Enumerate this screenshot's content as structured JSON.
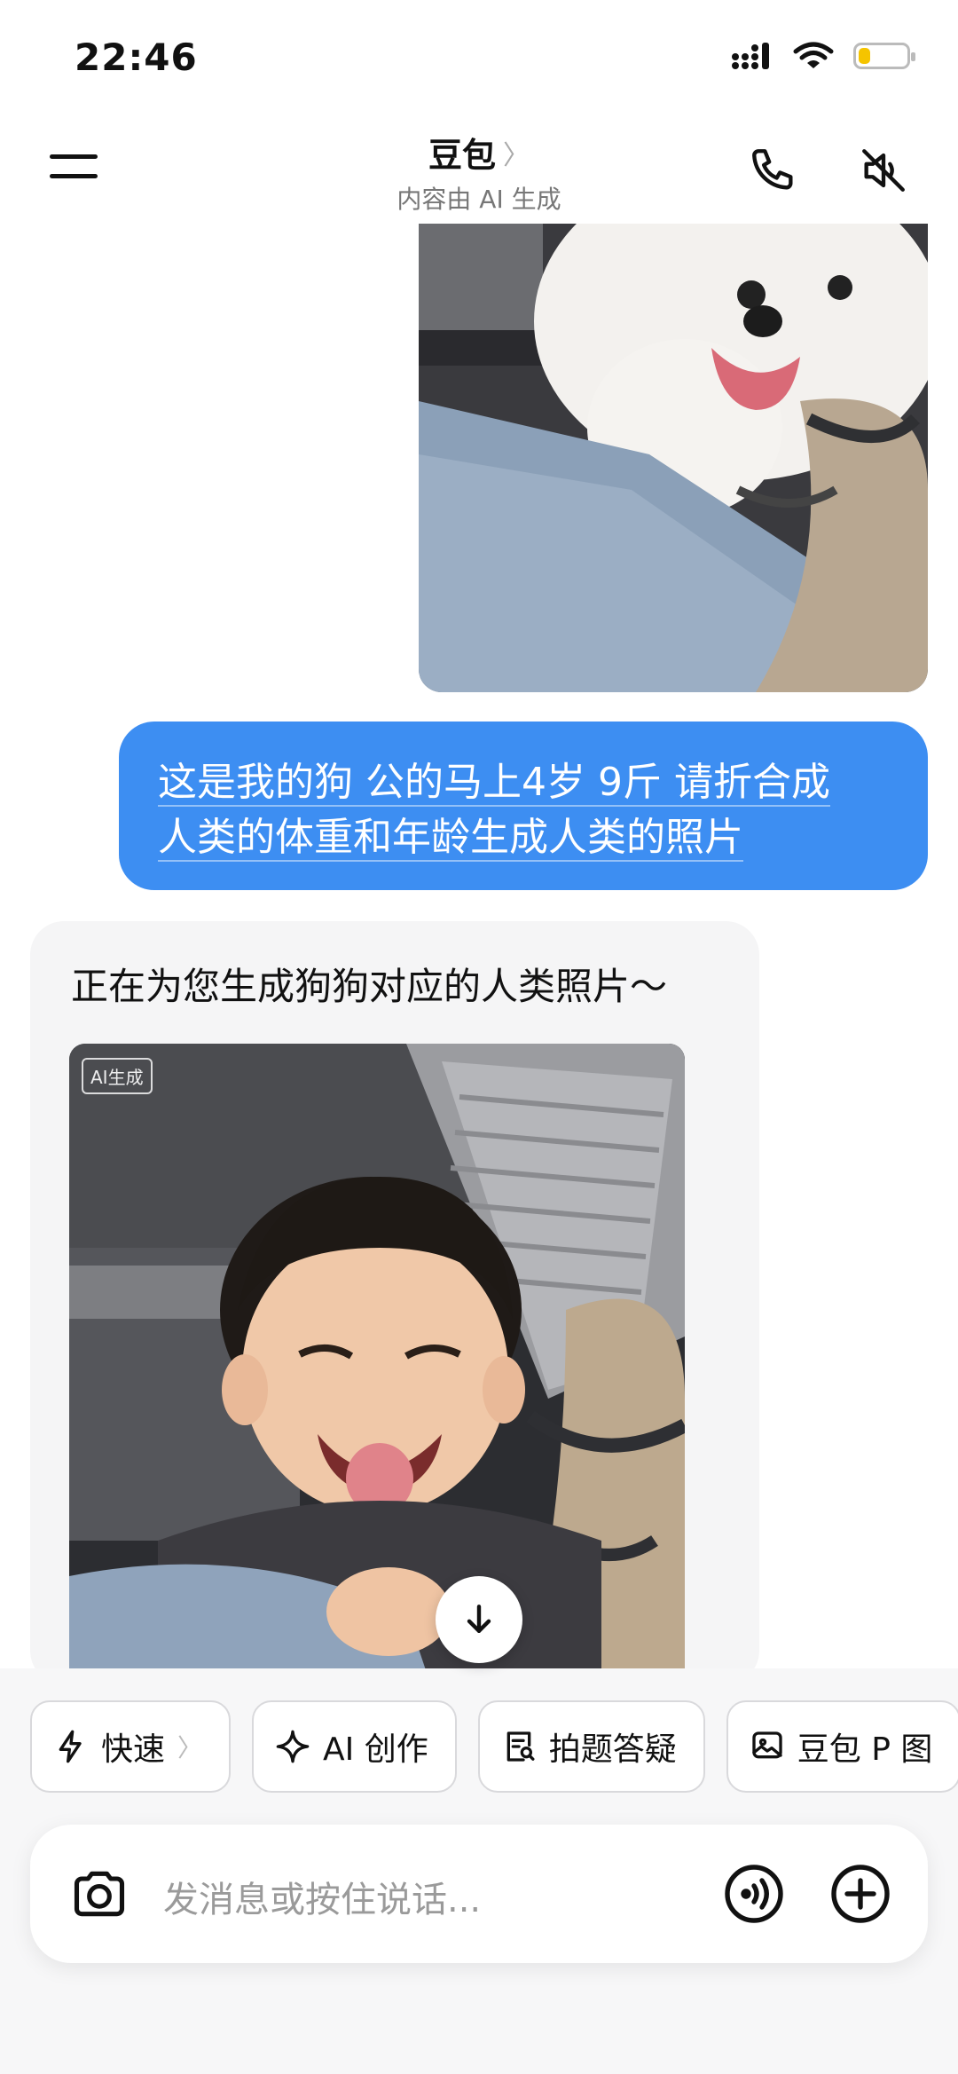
{
  "status_bar": {
    "time": "22:46",
    "battery_level": 0.25
  },
  "header": {
    "title": "豆包",
    "chevron": "〉",
    "subtitle": "内容由 AI 生成",
    "icons": [
      "menu-icon",
      "phone-icon",
      "speaker-muted-icon"
    ]
  },
  "messages": {
    "user_photo_alt": "dog-photo",
    "user_text_line1": "这是我的狗 公的马上4岁 9斤 请折合成",
    "user_text_line2": "人类的体重和年龄生成人类的照片",
    "bot_text": "正在为您生成狗狗对应的人类照片～",
    "ai_badge": "AI生成"
  },
  "chips": [
    {
      "label": "快速",
      "icon": "lightning-icon",
      "chevron": "〉"
    },
    {
      "label": "AI 创作",
      "icon": "sparkle-icon"
    },
    {
      "label": "拍题答疑",
      "icon": "search-doc-icon"
    },
    {
      "label": "豆包 P 图",
      "icon": "image-edit-icon"
    }
  ],
  "input": {
    "placeholder": "发消息或按住说话..."
  },
  "colors": {
    "user_bubble": "#3d8ef2",
    "bot_bubble": "#f5f5f6",
    "battery": "#f5c400"
  }
}
